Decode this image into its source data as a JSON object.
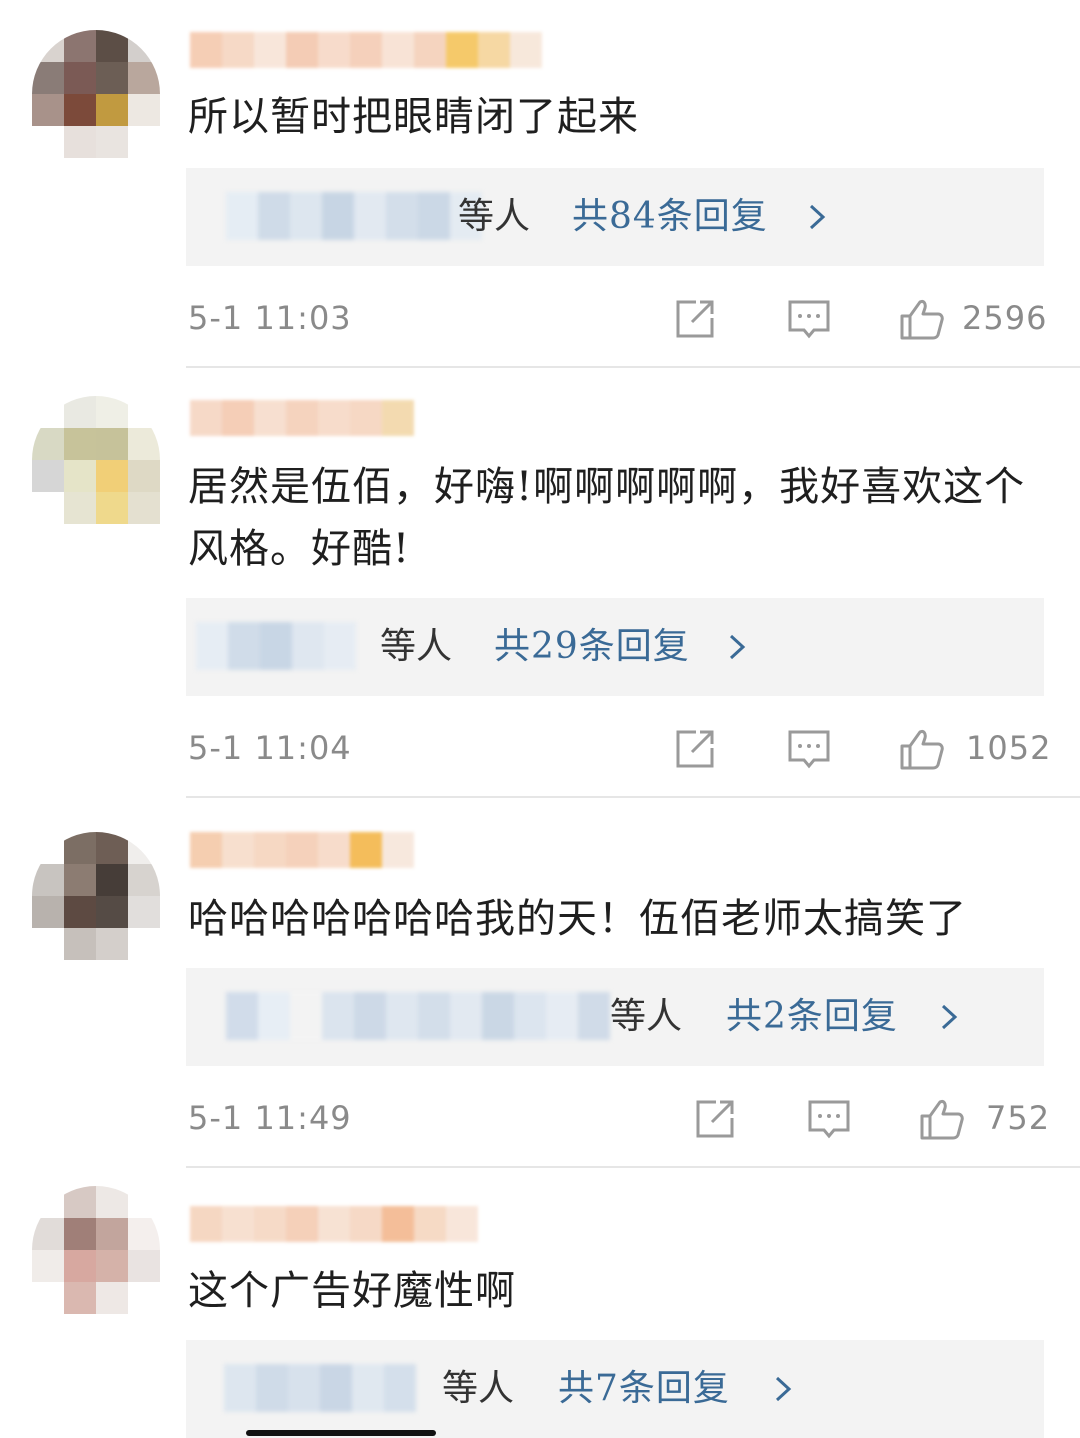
{
  "colors": {
    "reply_link": "#3a6a96",
    "meta_text": "#8a8a8a",
    "reply_bg": "#f3f3f3",
    "divider": "#e6e6e6"
  },
  "icons": {
    "share": "share-icon",
    "comment": "comment-icon",
    "like": "like-icon",
    "chevron": "chevron-right-icon"
  },
  "comments": [
    {
      "text": "所以暂时把眼睛闭了起来",
      "reply_suffix": "等人",
      "reply_count": "共84条回复",
      "time": "5-1  11:03",
      "likes": "2596"
    },
    {
      "text": "居然是伍佰，好嗨!啊啊啊啊啊，我好喜欢这个风格。好酷!",
      "reply_suffix": "等人",
      "reply_count": "共29条回复",
      "time": "5-1  11:04",
      "likes": "1052"
    },
    {
      "text": "哈哈哈哈哈哈哈我的天！伍佰老师太搞笑了",
      "reply_suffix": "等人",
      "reply_count": "共2条回复",
      "time": "5-1  11:49",
      "likes": "752"
    },
    {
      "text": "这个广告好魔性啊",
      "reply_suffix": "等人",
      "reply_count": "共7条回复"
    }
  ]
}
